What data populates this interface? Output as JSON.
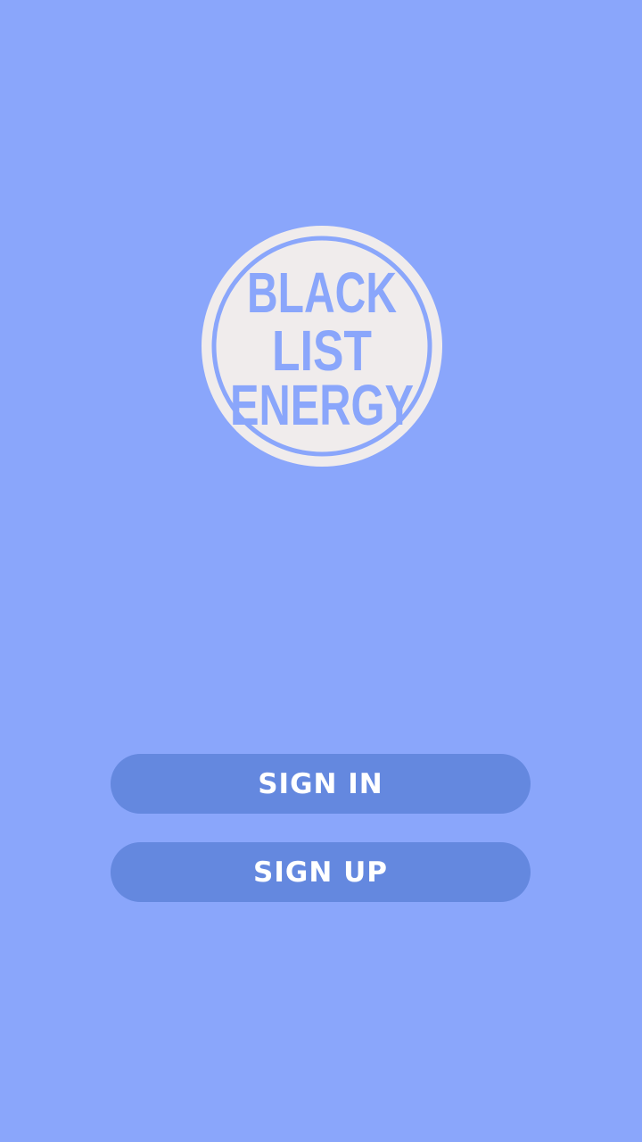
{
  "colors": {
    "background": "#8aa6fb",
    "button": "#6488df",
    "logo_fill": "#f0ecec",
    "logo_text": "#8aa6fb"
  },
  "logo": {
    "icon": "blacklist-energy-logo",
    "line1": "BLACK",
    "line2": "LIST",
    "line3": "ENERGY"
  },
  "actions": {
    "sign_in_label": "SIGN IN",
    "sign_up_label": "SIGN UP"
  }
}
